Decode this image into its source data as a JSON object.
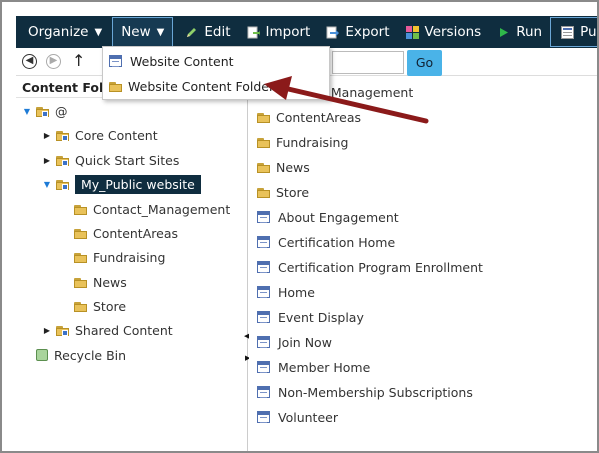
{
  "toolbar": {
    "organize": "Organize",
    "new": "New",
    "edit": "Edit",
    "import": "Import",
    "export": "Export",
    "versions": "Versions",
    "run": "Run",
    "publish": "Publish"
  },
  "nav": {
    "go_label": "Go"
  },
  "dropdown": {
    "items": [
      "Website Content",
      "Website Content Folder"
    ]
  },
  "left_panel": {
    "title": "Content Folders",
    "tree": {
      "root": "@",
      "core_content": "Core Content",
      "quick_start": "Quick Start Sites",
      "public_site": "My_Public website",
      "children": [
        "Contact_Management",
        "ContentAreas",
        "Fundraising",
        "News",
        "Store"
      ],
      "shared_content": "Shared Content",
      "recycle_bin": "Recycle Bin"
    }
  },
  "right_panel": {
    "items": [
      {
        "label": "Contact_Management",
        "icon": "folder-icon"
      },
      {
        "label": "ContentAreas",
        "icon": "folder-icon"
      },
      {
        "label": "Fundraising",
        "icon": "folder-icon"
      },
      {
        "label": "News",
        "icon": "folder-icon"
      },
      {
        "label": "Store",
        "icon": "folder-icon"
      },
      {
        "label": "About Engagement",
        "icon": "page-icon"
      },
      {
        "label": "Certification Home",
        "icon": "page-icon"
      },
      {
        "label": "Certification Program Enrollment",
        "icon": "page-icon"
      },
      {
        "label": "Home",
        "icon": "page-icon"
      },
      {
        "label": "Event Display",
        "icon": "page-icon"
      },
      {
        "label": "Join Now",
        "icon": "page-icon"
      },
      {
        "label": "Member Home",
        "icon": "page-icon"
      },
      {
        "label": "Non-Membership Subscriptions",
        "icon": "page-icon"
      },
      {
        "label": "Volunteer",
        "icon": "page-icon"
      }
    ]
  },
  "colors": {
    "toolbar_bg": "#0f2d3f",
    "selected_bg": "#0f2d3f",
    "go_button": "#4ab3e8",
    "annotation_arrow": "#8b1a1a"
  }
}
